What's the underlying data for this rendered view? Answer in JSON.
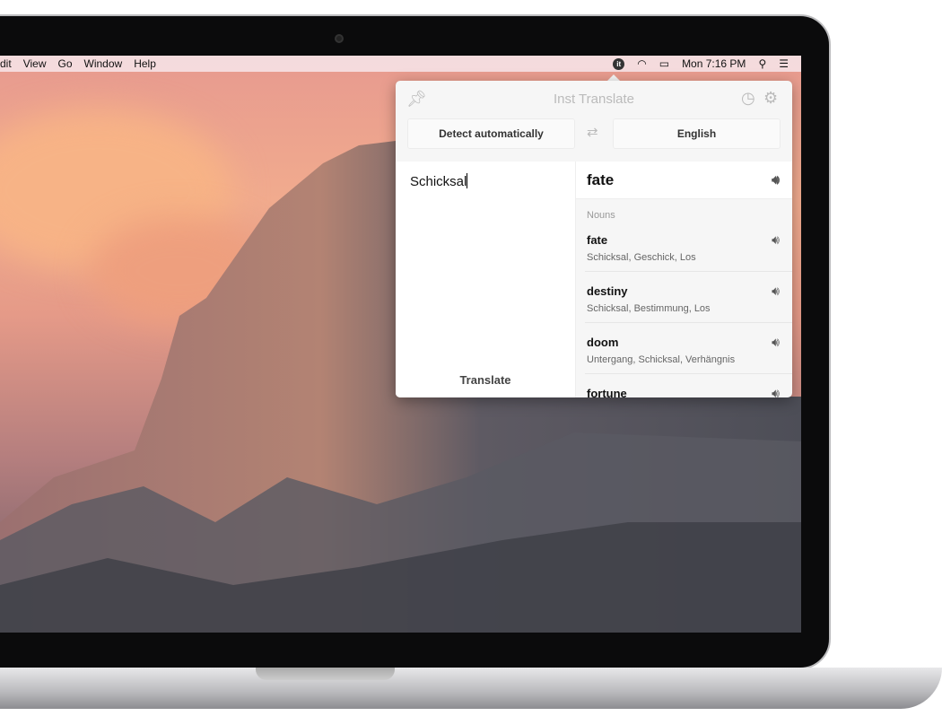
{
  "menubar": {
    "items": [
      "dit",
      "View",
      "Go",
      "Window",
      "Help"
    ],
    "clock": "Mon 7:16 PM",
    "app_icon": "it"
  },
  "popup": {
    "title": "Inst Translate",
    "source_lang": "Detect automatically",
    "target_lang": "English",
    "input": "Schicksal",
    "translate_label": "Translate",
    "result": "fate",
    "pos": "Nouns",
    "entries": [
      {
        "word": "fate",
        "syn": "Schicksal, Geschick, Los"
      },
      {
        "word": "destiny",
        "syn": "Schicksal, Bestimmung, Los"
      },
      {
        "word": "doom",
        "syn": "Untergang, Schicksal, Verhängnis"
      },
      {
        "word": "fortune",
        "syn": ""
      }
    ]
  }
}
